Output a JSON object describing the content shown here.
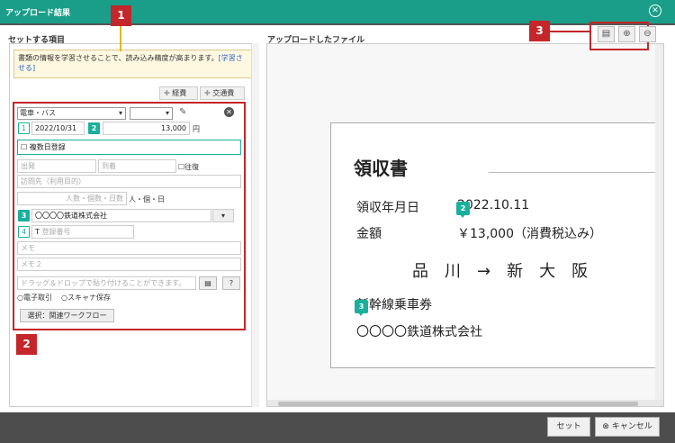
{
  "window": {
    "title": "アップロード結果",
    "close_icon": "⊗"
  },
  "left": {
    "header": "セットする項目",
    "info_text": "書類の情報を学習させることで、読み込み精度が高まります。",
    "info_link": "[学習させる]",
    "expense_btn": "経費",
    "transport_btn": "交通費",
    "category": "電車・バス",
    "date": "2022/10/31",
    "amount": "13,000",
    "yen": "円",
    "multi_date": "複数日登録",
    "departure": "出発",
    "arrival": "到着",
    "roundtrip": "往復",
    "visit_place": "訪問先（利用目的）",
    "people_placeholder": "人数・個数・日数",
    "unit": "人・個・日",
    "vendor": "〇〇〇〇鉄道株式会社",
    "reg_prefix": "T",
    "reg_placeholder": "登録番号",
    "memo": "メモ",
    "memo2": "メモ２",
    "dropzone": "ドラッグ＆ドロップで貼り付けることができます。",
    "e_transaction": "電子取引",
    "scanner": "スキャナ保存",
    "workflow_btn": "選択：関連ワークフロー",
    "num1": "1",
    "num2": "2",
    "num3": "3",
    "num4": "4"
  },
  "right": {
    "header": "アップロードしたファイル"
  },
  "doc": {
    "title": "領収書",
    "date_label": "領収年月日",
    "date_value": "2022.10.11",
    "amount_label": "金額",
    "amount_value": "￥13,000（消費税込み）",
    "route": "品　川　→　新　大　阪",
    "ticket": "新幹線乗車券",
    "company": "〇〇〇〇鉄道株式会社",
    "m2": "2",
    "m3": "3"
  },
  "callouts": {
    "c1": "1",
    "c2": "2",
    "c3": "3"
  },
  "footer": {
    "set_btn": "セット",
    "cancel_btn": "キャンセル"
  },
  "colors": {
    "teal": "#1a9e8a",
    "red": "#c5262a"
  }
}
